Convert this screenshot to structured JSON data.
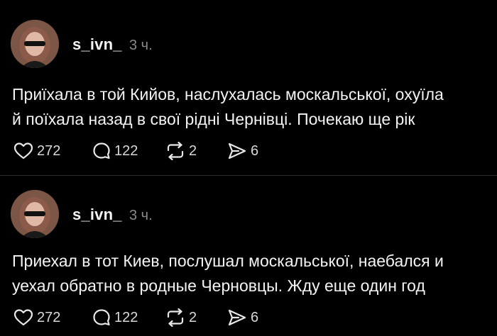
{
  "posts": [
    {
      "username": "s_ivn_",
      "time": "3 ч.",
      "text_lines": [
        "Приїхала в той Кийов, наслухалась москальської, охуїла",
        "й поїхала назад в свої рідні Чернівці. Почекаю ще рік"
      ],
      "likes": "272",
      "comments": "122",
      "reposts": "2",
      "shares": "6"
    },
    {
      "username": "s_ivn_",
      "time": "3 ч.",
      "text_lines": [
        "Приехал в тот Киев, послушал москальської, наебался и",
        "уехал обратно в родные Черновцы. Жду еще один год"
      ],
      "likes": "272",
      "comments": "122",
      "reposts": "2",
      "shares": "6"
    }
  ],
  "icons": {
    "like": "heart-icon",
    "comment": "comment-bubble-icon",
    "repost": "repost-icon",
    "share": "send-icon"
  }
}
